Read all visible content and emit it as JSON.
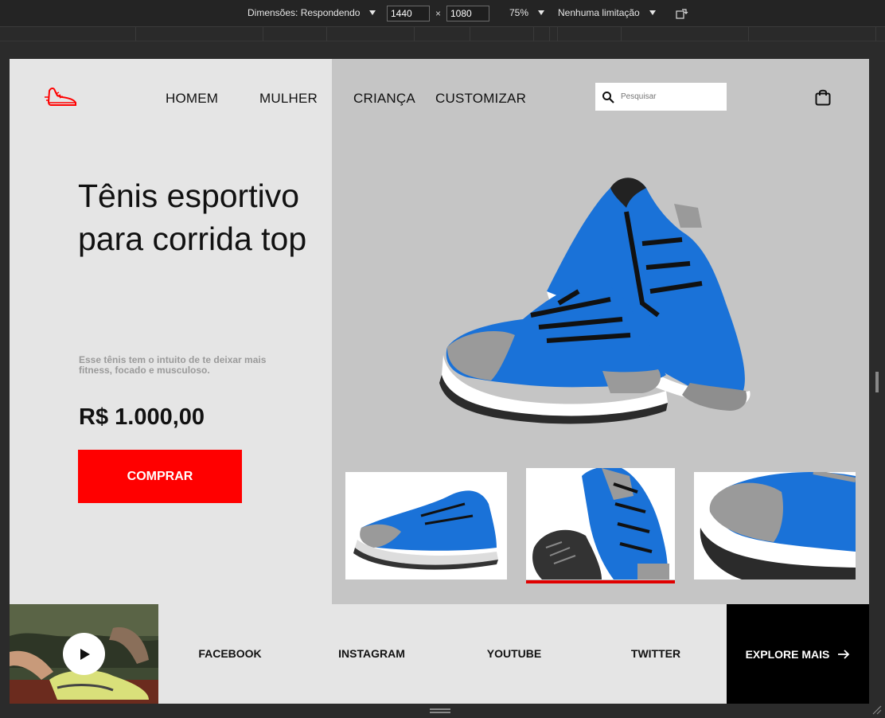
{
  "devtools": {
    "dimensions_label": "Dimensões: Respondendo",
    "width": "1440",
    "height": "1080",
    "times": "×",
    "zoom": "75%",
    "throttle": "Nenhuma limitação"
  },
  "nav": {
    "items": [
      "HOMEM",
      "MULHER",
      "CRIANÇA",
      "CUSTOMIZAR"
    ]
  },
  "search": {
    "placeholder": "Pesquisar"
  },
  "hero": {
    "title": "Tênis esportivo para corrida top",
    "description": "Esse tênis tem o intuito de te deixar mais fitness, focado e musculoso.",
    "price": "R$ 1.000,00",
    "buy_label": "COMPRAR"
  },
  "thumbnails": {
    "selected_index": 1,
    "count": 3
  },
  "footer": {
    "social": [
      "FACEBOOK",
      "INSTAGRAM",
      "YOUTUBE",
      "TWITTER"
    ],
    "explore_label": "EXPLORE MAIS"
  },
  "colors": {
    "accent": "#ff0000",
    "shoe_blue": "#1a72d8",
    "hero_bg": "#c5c5c5",
    "page_bg": "#e5e5e5"
  },
  "icons": [
    "shoe-logo-icon",
    "search-icon",
    "shopping-bag-icon",
    "play-icon",
    "arrow-right-icon"
  ]
}
